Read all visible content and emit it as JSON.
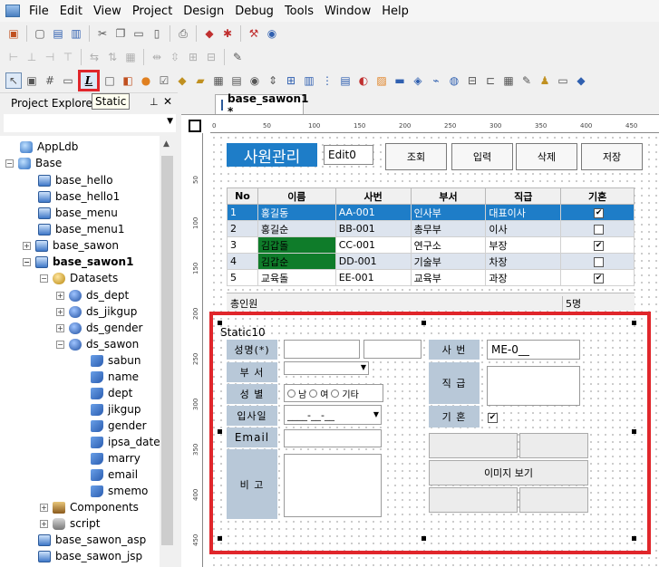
{
  "menu": [
    "File",
    "Edit",
    "View",
    "Project",
    "Design",
    "Debug",
    "Tools",
    "Window",
    "Help"
  ],
  "tooltip": "Static",
  "explorer": {
    "title": "Project Explorer",
    "tree": [
      {
        "label": "AppLdb",
        "icon": "db-icon"
      },
      {
        "label": "Base",
        "icon": "db-icon"
      },
      {
        "label": "base_hello",
        "icon": "form-icon"
      },
      {
        "label": "base_hello1",
        "icon": "form-icon"
      },
      {
        "label": "base_menu",
        "icon": "form-icon"
      },
      {
        "label": "base_menu1",
        "icon": "form-icon"
      },
      {
        "label": "base_sawon",
        "icon": "form-icon"
      },
      {
        "label": "base_sawon1",
        "icon": "form-icon"
      },
      {
        "label": "Datasets",
        "icon": "datasets-icon"
      },
      {
        "label": "ds_dept",
        "icon": "dataset-icon"
      },
      {
        "label": "ds_jikgup",
        "icon": "dataset-icon"
      },
      {
        "label": "ds_gender",
        "icon": "dataset-icon"
      },
      {
        "label": "ds_sawon",
        "icon": "dataset-icon"
      },
      {
        "label": "sabun",
        "icon": "column-icon"
      },
      {
        "label": "name",
        "icon": "column-icon"
      },
      {
        "label": "dept",
        "icon": "column-icon"
      },
      {
        "label": "jikgup",
        "icon": "column-icon"
      },
      {
        "label": "gender",
        "icon": "column-icon"
      },
      {
        "label": "ipsa_date",
        "icon": "column-icon"
      },
      {
        "label": "marry",
        "icon": "column-icon"
      },
      {
        "label": "email",
        "icon": "column-icon"
      },
      {
        "label": "smemo",
        "icon": "column-icon"
      },
      {
        "label": "Components",
        "icon": "components-icon"
      },
      {
        "label": "script",
        "icon": "script-icon"
      },
      {
        "label": "base_sawon_asp",
        "icon": "form-icon"
      },
      {
        "label": "base_sawon_jsp",
        "icon": "form-icon"
      }
    ]
  },
  "tab": {
    "label": "base_sawon1 *"
  },
  "ruler": {
    "top": [
      "0",
      "50",
      "100",
      "150",
      "200",
      "250",
      "300",
      "350",
      "400",
      "450"
    ],
    "left": [
      "50",
      "100",
      "150",
      "200",
      "250",
      "300",
      "350",
      "400",
      "450"
    ]
  },
  "form": {
    "title": "사원관리",
    "edit0": "Edit0",
    "buttons": [
      "조회",
      "입력",
      "삭제",
      "저장"
    ],
    "grid": {
      "headers": [
        "No",
        "이름",
        "사번",
        "부서",
        "직급",
        "기혼"
      ],
      "rows": [
        {
          "no": "1",
          "name": "홍길동",
          "sabun": "AA-001",
          "dept": "인사부",
          "jik": "대표이사",
          "marry": true
        },
        {
          "no": "2",
          "name": "홍길순",
          "sabun": "BB-001",
          "dept": "총무부",
          "jik": "이사",
          "marry": false
        },
        {
          "no": "3",
          "name": "김갑돌",
          "sabun": "CC-001",
          "dept": "연구소",
          "jik": "부장",
          "marry": true
        },
        {
          "no": "4",
          "name": "김갑순",
          "sabun": "DD-001",
          "dept": "기술부",
          "jik": "차장",
          "marry": false
        },
        {
          "no": "5",
          "name": "교육돌",
          "sabun": "EE-001",
          "dept": "교육부",
          "jik": "과장",
          "marry": true
        }
      ],
      "summary_label": "총인원",
      "summary_value": "5명"
    },
    "detail": {
      "static_label": "Static10",
      "name_label": "성명(*)",
      "dept_label": "부 서",
      "gender_label": "성 별",
      "ipsa_label": "입사일",
      "email_label": "Email",
      "bigo_label": "비 고",
      "sabun_label": "사 번",
      "jik_label": "직 급",
      "marry_label": "기 혼",
      "sabun_value": "ME-0__",
      "date_mask": "____-__-__",
      "radio_options": [
        "남",
        "여",
        "기타"
      ],
      "image_button": "이미지 보기"
    }
  }
}
